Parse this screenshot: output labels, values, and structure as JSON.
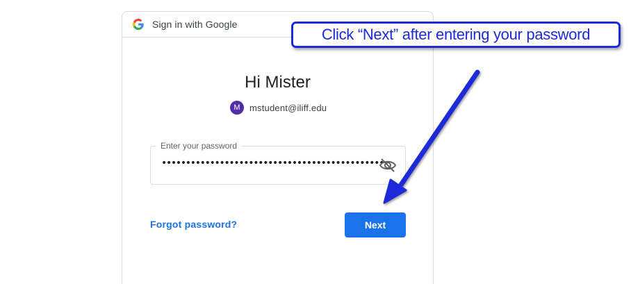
{
  "header": {
    "logo_icon": "google-g-icon",
    "title": "Sign in with Google"
  },
  "main": {
    "greeting": "Hi Mister",
    "account": {
      "avatar_initial": "M",
      "avatar_color": "#512da8",
      "email": "mstudent@iliff.edu"
    },
    "password": {
      "label": "Enter your password",
      "masked_value": "•••••••••••••••••••••••••••••••••••••••••••••••",
      "toggle_icon": "eye-slash-icon"
    },
    "forgot_link": "Forgot password?",
    "next_button": "Next"
  },
  "annotation": {
    "callout_text": "Click “Next” after entering your password",
    "color": "#1d2ad8"
  },
  "colors": {
    "accent": "#1a73e8",
    "border": "#dadce0"
  }
}
